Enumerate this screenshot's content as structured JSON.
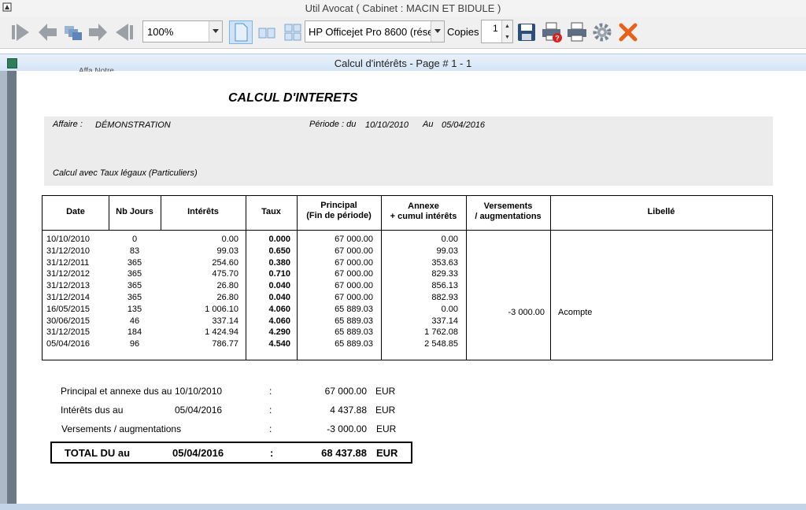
{
  "window": {
    "title": "Util Avocat ( Cabinet : MACIN ET BIDULE )"
  },
  "toolbar": {
    "zoom": "100%",
    "printer": "HP Officejet Pro 8600 (rése",
    "copies_label": "Copies",
    "copies_value": "1"
  },
  "document": {
    "title": "Calcul d'intérêts - Page # 1 - 1",
    "cropped_text": "Affa Notre",
    "report_title": "CALCUL D'INTERETS",
    "affaire_label": "Affaire :",
    "affaire_value": "DÉMONSTRATION",
    "periode_label": "Période : du",
    "periode_from": "10/10/2010",
    "periode_au": "Au",
    "periode_to": "05/04/2016",
    "calc_note": "Calcul avec Taux légaux (Particuliers)"
  },
  "table": {
    "headers": {
      "date": "Date",
      "nb_jours": "Nb Jours",
      "interets": "Intérêts",
      "taux": "Taux",
      "principal_1": "Principal",
      "principal_2": "(Fin de période)",
      "annexe_1": "Annexe",
      "annexe_2": "+ cumul intérêts",
      "versements_1": "Versements",
      "versements_2": "/ augmentations",
      "libelle": "Libellé"
    },
    "rows": [
      {
        "date": "10/10/2010",
        "jours": "0",
        "interets": "0.00",
        "taux": "0.000",
        "principal": "67 000.00",
        "annexe": "0.00"
      },
      {
        "date": "31/12/2010",
        "jours": "83",
        "interets": "99.03",
        "taux": "0.650",
        "principal": "67 000.00",
        "annexe": "99.03"
      },
      {
        "date": "31/12/2011",
        "jours": "365",
        "interets": "254.60",
        "taux": "0.380",
        "principal": "67 000.00",
        "annexe": "353.63"
      },
      {
        "date": "31/12/2012",
        "jours": "365",
        "interets": "475.70",
        "taux": "0.710",
        "principal": "67 000.00",
        "annexe": "829.33"
      },
      {
        "date": "31/12/2013",
        "jours": "365",
        "interets": "26.80",
        "taux": "0.040",
        "principal": "67 000.00",
        "annexe": "856.13"
      },
      {
        "date": "31/12/2014",
        "jours": "365",
        "interets": "26.80",
        "taux": "0.040",
        "principal": "67 000.00",
        "annexe": "882.93"
      },
      {
        "date": "16/05/2015",
        "jours": "135",
        "interets": "1 006.10",
        "taux": "4.060",
        "principal": "65 889.03",
        "annexe": "0.00"
      },
      {
        "date": "30/06/2015",
        "jours": "46",
        "interets": "337.14",
        "taux": "4.060",
        "principal": "65 889.03",
        "annexe": "337.14"
      },
      {
        "date": "31/12/2015",
        "jours": "184",
        "interets": "1 424.94",
        "taux": "4.290",
        "principal": "65 889.03",
        "annexe": "1 762.08"
      },
      {
        "date": "05/04/2016",
        "jours": "96",
        "interets": "786.77",
        "taux": "4.540",
        "principal": "65 889.03",
        "annexe": "2 548.85"
      }
    ],
    "versement": "-3 000.00",
    "libelle": "Acompte"
  },
  "summary": {
    "principal_label": "Principal et annexe dus au",
    "principal_date": "10/10/2010",
    "principal_value": "67 000.00",
    "interets_label": "Intérêts dus au",
    "interets_date": "05/04/2016",
    "interets_value": "4 437.88",
    "versements_label": "Versements / augmentations",
    "versements_value": "-3 000.00",
    "colon": ":",
    "currency": "EUR",
    "total_label": "TOTAL DU au",
    "total_date": "05/04/2016",
    "total_value": "68 437.88"
  },
  "icons": [
    "first-page-icon",
    "prev-page-icon",
    "multi-page-icon",
    "next-page-icon",
    "last-page-icon",
    "single-page-view-icon",
    "two-page-view-icon",
    "four-page-view-icon",
    "save-icon",
    "print-help-icon",
    "print-icon",
    "settings-gear-icon",
    "close-icon"
  ],
  "colors": {
    "accent": "#3f7fd0",
    "close": "#e8611a"
  }
}
